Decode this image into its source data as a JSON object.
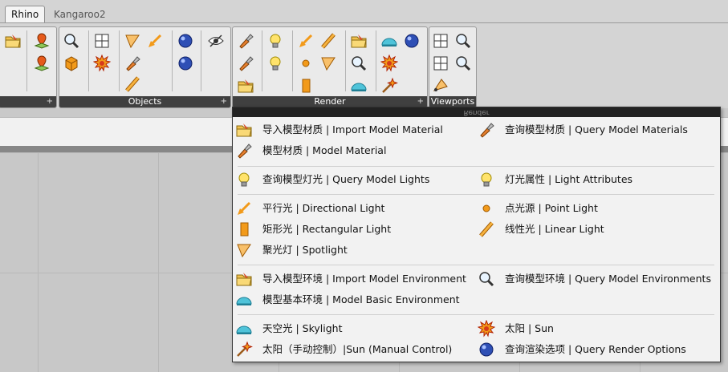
{
  "tabs": [
    {
      "label": "Rhino",
      "active": true
    },
    {
      "label": "Kangaroo2",
      "active": false
    }
  ],
  "ribbon": {
    "panels": [
      {
        "title": ""
      },
      {
        "title": "Objects"
      },
      {
        "title": "Render"
      },
      {
        "title": "Viewports"
      }
    ],
    "expand_glyph": "+"
  },
  "dropdown": {
    "header": "Render",
    "groups": [
      {
        "items": [
          {
            "label": "导入模型材质 | Import Model Material",
            "icon": "import-material-icon"
          },
          {
            "label": "查询模型材质 | Query Model Materials",
            "icon": "query-material-icon"
          },
          {
            "label": "模型材质 | Model Material",
            "icon": "model-material-icon"
          }
        ]
      },
      {
        "items": [
          {
            "label": "查询模型灯光 | Query Model Lights",
            "icon": "query-lights-icon"
          },
          {
            "label": "灯光属性 | Light Attributes",
            "icon": "light-bulb-icon"
          }
        ]
      },
      {
        "items": [
          {
            "label": "平行光 | Directional Light",
            "icon": "directional-light-icon"
          },
          {
            "label": "点光源 | Point Light",
            "icon": "point-light-icon"
          },
          {
            "label": "矩形光 | Rectangular Light",
            "icon": "rectangular-light-icon"
          },
          {
            "label": "线性光 | Linear Light",
            "icon": "linear-light-icon"
          },
          {
            "label": "聚光灯 | Spotlight",
            "icon": "spotlight-icon"
          }
        ]
      },
      {
        "items": [
          {
            "label": "导入模型环境 | Import Model Environment",
            "icon": "import-environment-icon"
          },
          {
            "label": "查询模型环境 | Query Model Environments",
            "icon": "query-environment-icon"
          },
          {
            "label": "模型基本环境 | Model Basic Environment",
            "icon": "basic-environment-icon"
          }
        ]
      },
      {
        "items": [
          {
            "label": "天空光 | Skylight",
            "icon": "skylight-icon"
          },
          {
            "label": "太阳 | Sun",
            "icon": "sun-icon"
          },
          {
            "label": "太阳（手动控制）|Sun (Manual Control)",
            "icon": "manual-sun-icon"
          },
          {
            "label": "查询渲染选项 | Query Render Options",
            "icon": "query-render-options-icon"
          }
        ]
      }
    ]
  },
  "colors": {
    "accent_orange": "#f29a1a",
    "dome_cyan": "#4fc3d9",
    "panel_title_bg": "#404040",
    "menu_bg": "#f2f2f2"
  }
}
